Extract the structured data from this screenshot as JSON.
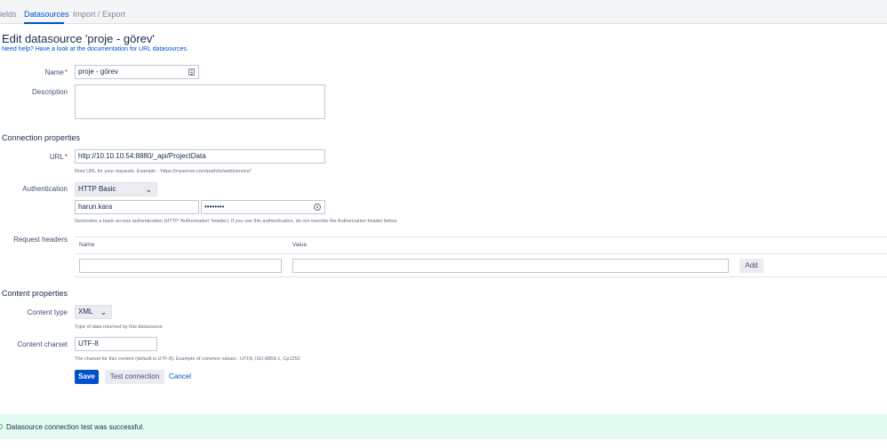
{
  "tabs": [
    {
      "label": "ields"
    },
    {
      "label": "Datasources"
    },
    {
      "label": "Import / Export"
    }
  ],
  "page": {
    "title": "Edit datasource 'proje - görev'",
    "help_link": "Need help? Have a look at the documentation for URL datasources."
  },
  "form": {
    "name_label": "Name",
    "name_required": "*",
    "name_value": "proje - görev",
    "description_label": "Description",
    "description_value": ""
  },
  "connection": {
    "section_title": "Connection properties",
    "url_label": "URL",
    "url_required": "*",
    "url_value": "http://10.10.10.54:8880/_api/ProjectData",
    "url_hint": "Root URL for your requests. Example : 'https://myserver.com/path/to/web/service/'",
    "auth_label": "Authentication",
    "auth_value": "HTTP Basic",
    "username_value": "harun.kara",
    "password_value": "••••••••",
    "auth_hint": "Generates a basic access authentication (HTTP 'Authorization' header). If you use this authentication, do not override the Authorization header below.",
    "headers_label": "Request headers",
    "headers_col_name": "Name",
    "headers_col_value": "Value",
    "header_name_value": "",
    "header_value_value": "",
    "add_button": "Add"
  },
  "content": {
    "section_title": "Content properties",
    "type_label": "Content type",
    "type_value": "XML",
    "type_hint": "Type of data returned by this datasource.",
    "charset_label": "Content charset",
    "charset_value": "UTF-8",
    "charset_hint": "The charset for this content (default is UTF-8). Example of common values : UTF8, ISO-8859-1, Cp1252"
  },
  "actions": {
    "save": "Save",
    "test": "Test connection",
    "cancel": "Cancel"
  },
  "flag": {
    "message": "Datasource connection test was successful."
  },
  "colors": {
    "accent": "#0052cc",
    "success_bg": "#e3fcef"
  }
}
